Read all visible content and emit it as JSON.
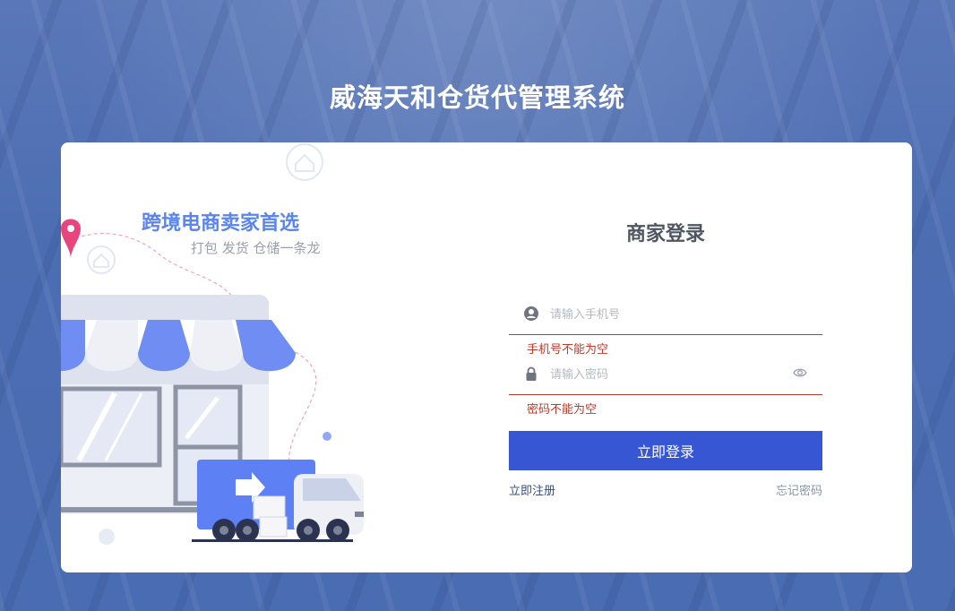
{
  "app": {
    "title": "威海天和仓货代管理系统"
  },
  "promo": {
    "title": "跨境电商卖家首选",
    "subtitle": "打包 发货 仓储一条龙"
  },
  "login": {
    "title": "商家登录",
    "phone": {
      "placeholder": "请输入手机号",
      "value": "",
      "error": "手机号不能为空"
    },
    "password": {
      "placeholder": "请输入密码",
      "value": "",
      "error": "密码不能为空"
    },
    "submit_label": "立即登录",
    "register_label": "立即注册",
    "forgot_label": "忘记密码"
  },
  "colors": {
    "accent": "#3656d4",
    "error": "#c0392b",
    "promo": "#5a84f0",
    "background": "#4d6db3"
  },
  "icons": {
    "phone_field": "user-circle-icon",
    "password_field": "lock-icon",
    "password_toggle": "eye-icon",
    "location_pin": "map-pin-icon",
    "home_badge": "home-icon"
  }
}
